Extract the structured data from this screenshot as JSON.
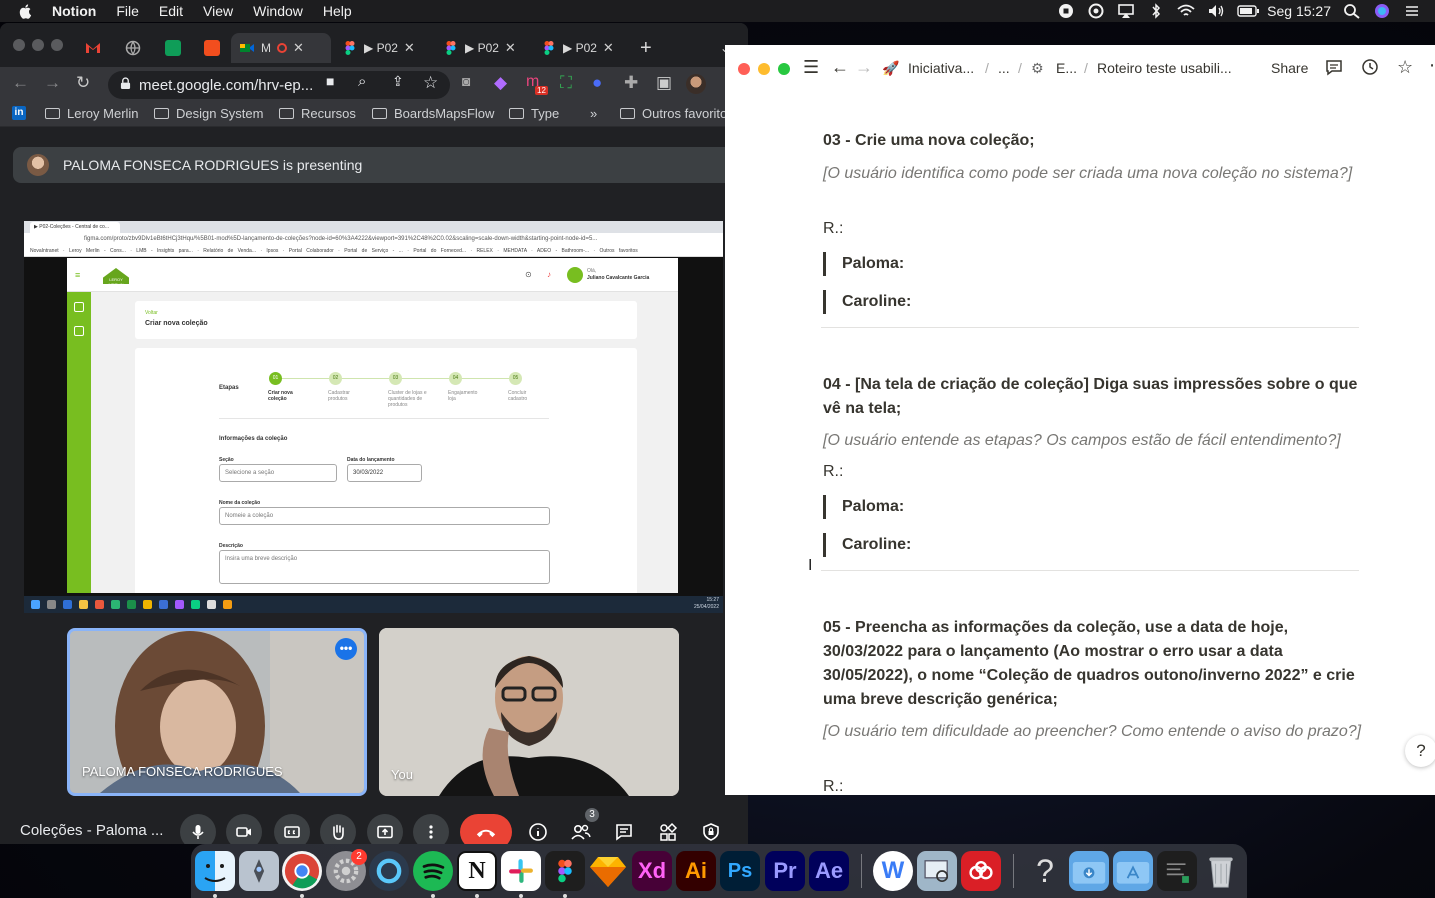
{
  "menubar": {
    "app_name": "Notion",
    "menus": [
      "File",
      "Edit",
      "View",
      "Window",
      "Help"
    ],
    "datetime": "Seg 15:27"
  },
  "chrome": {
    "tabs": [
      {
        "label": ""
      },
      {
        "label": ""
      },
      {
        "label": ""
      },
      {
        "label": ""
      },
      {
        "label": "M"
      },
      {
        "label": "▶ P02"
      },
      {
        "label": "▶ P02"
      },
      {
        "label": "▶ P02"
      }
    ],
    "new_tab": "+",
    "url": "meet.google.com/hrv-ep...",
    "extension_badge": "12",
    "bookmarks": [
      "Leroy Merlin",
      "Design System",
      "Recursos",
      "BoardsMapsFlow",
      "Type"
    ],
    "bookmarks_more": "»",
    "other_bookmarks": "Outros favorito"
  },
  "meet": {
    "presenting_text": "PALOMA FONSECA RODRIGUES is presenting",
    "shared_screen": {
      "tab_title": "▶ P02-Coleções - Central de co...",
      "url": "figma.com/proto/zbv9Dlv1eBt6tHCj3tHqu/%5B01-mod%5D-lançamento-de-coleções?node-id=60%3A4222&viewport=391%2C48%2C0.02&scaling=scale-down-width&starting-point-node-id=5...",
      "bookmarks_bar": "NovaIntranet · Leroy Merlin - Cons... · LMB - Insights para... · Relatório de Venda... · Ipsos · Portal Colaborador · Portal de Serviço - ... · Portal do Forneced... · RELEX · MEHDATA · ADEO - Bathroom-... · Outros favoritos",
      "logo_text": "LEROY MERLIN",
      "user_greeting": "Olá,",
      "user_name": "Juliano Cavalcante Garcia",
      "back_link": "Voltar",
      "page_title": "Criar nova coleção",
      "steps_label": "Etapas",
      "steps": [
        {
          "num": "01",
          "label": "Criar nova coleção"
        },
        {
          "num": "02",
          "label": "Cadastrar produtos"
        },
        {
          "num": "03",
          "label": "Cluster de lojas e quantidades de produtos"
        },
        {
          "num": "04",
          "label": "Engajamento loja"
        },
        {
          "num": "05",
          "label": "Concluir cadastro"
        }
      ],
      "section_title": "Informações da coleção",
      "section_label": "Seção",
      "section_placeholder": "Selecione a seção",
      "launch_label": "Data do lançamento",
      "launch_value": "30/03/2022",
      "name_label": "Nome da coleção",
      "name_placeholder": "Nomeie a coleção",
      "desc_label": "Descrição",
      "desc_placeholder": "Insira uma breve descrição",
      "taskbar_time": "15:27",
      "taskbar_date": "25/04/2022"
    },
    "tiles": [
      {
        "name": "PALOMA FONSECA RODRIGUES"
      },
      {
        "name": "You"
      }
    ],
    "meeting_name": "Coleções - Paloma ...",
    "people_count": "3"
  },
  "notion": {
    "breadcrumbs": [
      "Iniciativa...",
      "...",
      "E...",
      "Roteiro teste usabili..."
    ],
    "share_label": "Share",
    "sections": [
      {
        "question": "03 - Crie uma nova coleção;",
        "hint": "[O usuário identifica como pode ser criada uma nova coleção no sistema?]",
        "answer_label": "R.:",
        "quotes": [
          "Paloma:",
          "Caroline:"
        ]
      },
      {
        "question": "04 - [Na tela de criação de coleção] Diga suas impressões sobre o que vê na tela;",
        "hint": "[O usuário entende as etapas? Os campos estão de fácil entendimento?]",
        "answer_label": "R.:",
        "quotes": [
          "Paloma:",
          "Caroline:"
        ]
      },
      {
        "question": "05 - Preencha as informações da coleção, use a data de hoje, 30/03/2022 para o lançamento (Ao mostrar o erro usar a data 30/05/2022), o nome “Coleção de quadros outono/inverno 2022” e crie uma breve descrição genérica;",
        "hint": "[O usuário tem dificuldade ao preencher? Como entende o aviso do prazo?]",
        "answer_label": "R.:"
      }
    ],
    "help_label": "?"
  },
  "dock": {
    "settings_badge": "2",
    "apps": [
      "Finder",
      "Launchpad",
      "Chrome",
      "System Preferences",
      "Proxyman",
      "Spotify",
      "Notion",
      "Slack",
      "Figma",
      "Sketch",
      "Adobe XD",
      "Illustrator",
      "Photoshop",
      "Premiere Pro",
      "After Effects",
      "Whimsical",
      "Preview",
      "Creative Cloud",
      "Help",
      "Downloads",
      "Applications",
      "Terminal",
      "Trash"
    ],
    "labels": {
      "xd": "Xd",
      "ai": "Ai",
      "ps": "Ps",
      "pr": "Pr",
      "ae": "Ae",
      "notion": "N",
      "whimsical": "W",
      "help": "?"
    }
  },
  "colors": {
    "meet_bg": "#202124",
    "hangup": "#ea4335",
    "leroy_green": "#78be20",
    "notion_text": "#37352f",
    "notion_hint": "#787774"
  }
}
